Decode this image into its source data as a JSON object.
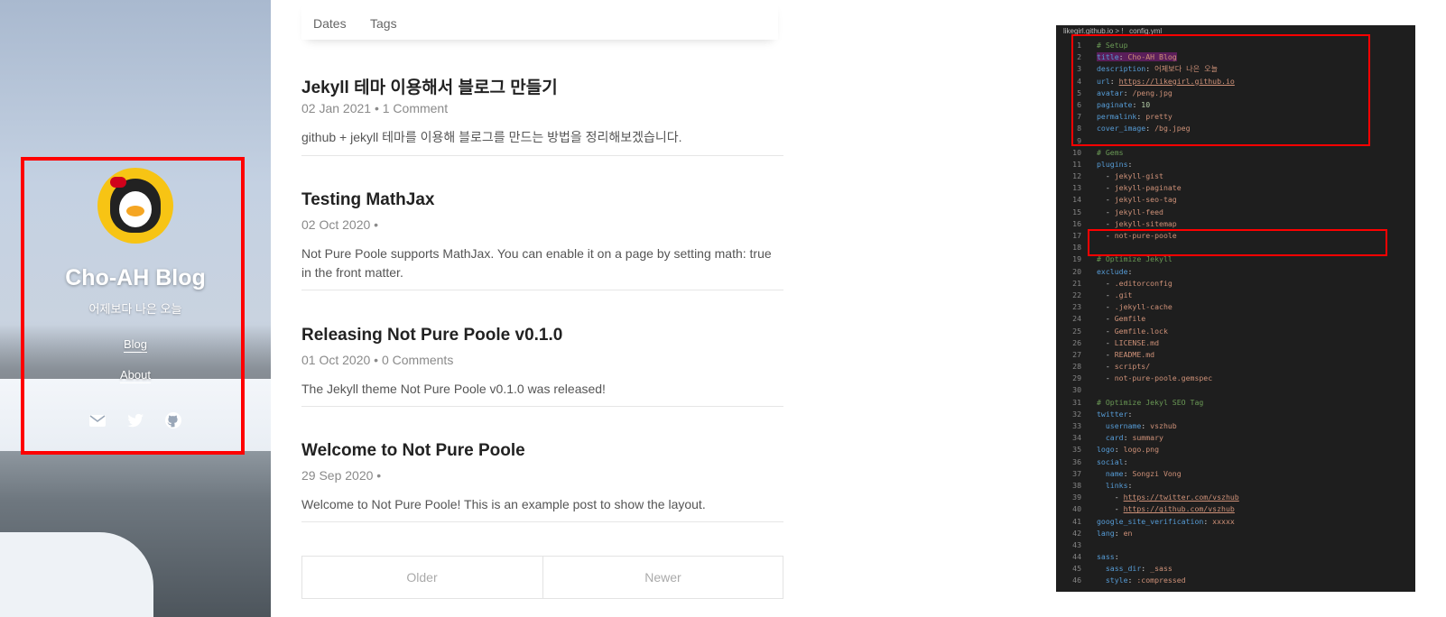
{
  "sidebar": {
    "title": "Cho-AH Blog",
    "description": "어제보다 나은 오늘",
    "nav": [
      {
        "label": "Blog"
      },
      {
        "label": "About"
      }
    ],
    "social_icons": [
      "email-icon",
      "twitter-icon",
      "github-icon"
    ]
  },
  "tabs": [
    {
      "label": "Dates"
    },
    {
      "label": "Tags"
    }
  ],
  "posts": [
    {
      "title": "Jekyll 테마 이용해서 블로그 만들기",
      "meta": "02 Jan 2021 • 1 Comment",
      "excerpt": "github + jekyll 테마를 이용해 블로그를 만드는 방법을 정리해보겠습니다."
    },
    {
      "title": "Testing MathJax",
      "meta": "02 Oct 2020 •",
      "excerpt": "Not Pure Poole supports MathJax. You can enable it on a page by setting math: true in the front matter."
    },
    {
      "title": "Releasing Not Pure Poole v0.1.0",
      "meta": "01 Oct 2020 • 0 Comments",
      "excerpt": "The Jekyll theme Not Pure Poole v0.1.0 was released!"
    },
    {
      "title": "Welcome to Not Pure Poole",
      "meta": "29 Sep 2020 •",
      "excerpt": "Welcome to Not Pure Poole! This is an example post to show the layout."
    }
  ],
  "pager": {
    "older": "Older",
    "newer": "Newer"
  },
  "editor": {
    "breadcrumb": "likegirl.github.io  >  !  _config.yml",
    "lines": [
      {
        "n": "1",
        "parts": [
          {
            "t": "# Setup",
            "c": "c-comment"
          }
        ]
      },
      {
        "n": "2",
        "parts": [
          {
            "t": "title",
            "c": "c-key hl"
          },
          {
            "t": ": ",
            "c": "c-punct hl"
          },
          {
            "t": "Cho-AH Blog",
            "c": "c-str hl"
          }
        ]
      },
      {
        "n": "3",
        "parts": [
          {
            "t": "description",
            "c": "c-key"
          },
          {
            "t": ": ",
            "c": "c-punct"
          },
          {
            "t": "어제보다 나은 오늘",
            "c": "c-str"
          }
        ]
      },
      {
        "n": "4",
        "parts": [
          {
            "t": "url",
            "c": "c-key"
          },
          {
            "t": ": ",
            "c": "c-punct"
          },
          {
            "t": "https://likegirl.github.io",
            "c": "c-link"
          }
        ]
      },
      {
        "n": "5",
        "parts": [
          {
            "t": "avatar",
            "c": "c-key"
          },
          {
            "t": ": ",
            "c": "c-punct"
          },
          {
            "t": "/peng.jpg",
            "c": "c-str"
          }
        ]
      },
      {
        "n": "6",
        "parts": [
          {
            "t": "paginate",
            "c": "c-key"
          },
          {
            "t": ": ",
            "c": "c-punct"
          },
          {
            "t": "10",
            "c": "c-num"
          }
        ]
      },
      {
        "n": "7",
        "parts": [
          {
            "t": "permalink",
            "c": "c-key"
          },
          {
            "t": ": ",
            "c": "c-punct"
          },
          {
            "t": "pretty",
            "c": "c-str"
          }
        ]
      },
      {
        "n": "8",
        "parts": [
          {
            "t": "cover_image",
            "c": "c-key"
          },
          {
            "t": ": ",
            "c": "c-punct"
          },
          {
            "t": "/bg.jpeg",
            "c": "c-str"
          }
        ]
      },
      {
        "n": "9",
        "parts": []
      },
      {
        "n": "10",
        "parts": [
          {
            "t": "# Gems",
            "c": "c-comment"
          }
        ]
      },
      {
        "n": "11",
        "parts": [
          {
            "t": "plugins",
            "c": "c-key"
          },
          {
            "t": ":",
            "c": "c-punct"
          }
        ]
      },
      {
        "n": "12",
        "parts": [
          {
            "t": "  - ",
            "c": "c-punct"
          },
          {
            "t": "jekyll-gist",
            "c": "c-str"
          }
        ]
      },
      {
        "n": "13",
        "parts": [
          {
            "t": "  - ",
            "c": "c-punct"
          },
          {
            "t": "jekyll-paginate",
            "c": "c-str"
          }
        ]
      },
      {
        "n": "14",
        "parts": [
          {
            "t": "  - ",
            "c": "c-punct"
          },
          {
            "t": "jekyll-seo-tag",
            "c": "c-str"
          }
        ]
      },
      {
        "n": "15",
        "parts": [
          {
            "t": "  - ",
            "c": "c-punct"
          },
          {
            "t": "jekyll-feed",
            "c": "c-str"
          }
        ]
      },
      {
        "n": "16",
        "parts": [
          {
            "t": "  - ",
            "c": "c-punct"
          },
          {
            "t": "jekyll-sitemap",
            "c": "c-str"
          }
        ]
      },
      {
        "n": "17",
        "parts": [
          {
            "t": "  - ",
            "c": "c-punct"
          },
          {
            "t": "not-pure-poole",
            "c": "c-str"
          }
        ]
      },
      {
        "n": "18",
        "parts": []
      },
      {
        "n": "19",
        "parts": [
          {
            "t": "# Optimize Jekyll",
            "c": "c-comment"
          }
        ]
      },
      {
        "n": "20",
        "parts": [
          {
            "t": "exclude",
            "c": "c-key"
          },
          {
            "t": ":",
            "c": "c-punct"
          }
        ]
      },
      {
        "n": "21",
        "parts": [
          {
            "t": "  - ",
            "c": "c-punct"
          },
          {
            "t": ".editorconfig",
            "c": "c-str"
          }
        ]
      },
      {
        "n": "22",
        "parts": [
          {
            "t": "  - ",
            "c": "c-punct"
          },
          {
            "t": ".git",
            "c": "c-str"
          }
        ]
      },
      {
        "n": "23",
        "parts": [
          {
            "t": "  - ",
            "c": "c-punct"
          },
          {
            "t": ".jekyll-cache",
            "c": "c-str"
          }
        ]
      },
      {
        "n": "24",
        "parts": [
          {
            "t": "  - ",
            "c": "c-punct"
          },
          {
            "t": "Gemfile",
            "c": "c-str"
          }
        ]
      },
      {
        "n": "25",
        "parts": [
          {
            "t": "  - ",
            "c": "c-punct"
          },
          {
            "t": "Gemfile.lock",
            "c": "c-str"
          }
        ]
      },
      {
        "n": "26",
        "parts": [
          {
            "t": "  - ",
            "c": "c-punct"
          },
          {
            "t": "LICENSE.md",
            "c": "c-str"
          }
        ]
      },
      {
        "n": "27",
        "parts": [
          {
            "t": "  - ",
            "c": "c-punct"
          },
          {
            "t": "README.md",
            "c": "c-str"
          }
        ]
      },
      {
        "n": "28",
        "parts": [
          {
            "t": "  - ",
            "c": "c-punct"
          },
          {
            "t": "scripts/",
            "c": "c-str"
          }
        ]
      },
      {
        "n": "29",
        "parts": [
          {
            "t": "  - ",
            "c": "c-punct"
          },
          {
            "t": "not-pure-poole.gemspec",
            "c": "c-str"
          }
        ]
      },
      {
        "n": "30",
        "parts": []
      },
      {
        "n": "31",
        "parts": [
          {
            "t": "# Optimize Jekyl SEO Tag",
            "c": "c-comment"
          }
        ]
      },
      {
        "n": "32",
        "parts": [
          {
            "t": "twitter",
            "c": "c-key"
          },
          {
            "t": ":",
            "c": "c-punct"
          }
        ]
      },
      {
        "n": "33",
        "parts": [
          {
            "t": "  username",
            "c": "c-key"
          },
          {
            "t": ": ",
            "c": "c-punct"
          },
          {
            "t": "vszhub",
            "c": "c-str"
          }
        ]
      },
      {
        "n": "34",
        "parts": [
          {
            "t": "  card",
            "c": "c-key"
          },
          {
            "t": ": ",
            "c": "c-punct"
          },
          {
            "t": "summary",
            "c": "c-str"
          }
        ]
      },
      {
        "n": "35",
        "parts": [
          {
            "t": "logo",
            "c": "c-key"
          },
          {
            "t": ": ",
            "c": "c-punct"
          },
          {
            "t": "logo.png",
            "c": "c-str"
          }
        ]
      },
      {
        "n": "36",
        "parts": [
          {
            "t": "social",
            "c": "c-key"
          },
          {
            "t": ":",
            "c": "c-punct"
          }
        ]
      },
      {
        "n": "37",
        "parts": [
          {
            "t": "  name",
            "c": "c-key"
          },
          {
            "t": ": ",
            "c": "c-punct"
          },
          {
            "t": "Songzi Vong",
            "c": "c-str"
          }
        ]
      },
      {
        "n": "38",
        "parts": [
          {
            "t": "  links",
            "c": "c-key"
          },
          {
            "t": ":",
            "c": "c-punct"
          }
        ]
      },
      {
        "n": "39",
        "parts": [
          {
            "t": "    - ",
            "c": "c-punct"
          },
          {
            "t": "https://twitter.com/vszhub",
            "c": "c-link"
          }
        ]
      },
      {
        "n": "40",
        "parts": [
          {
            "t": "    - ",
            "c": "c-punct"
          },
          {
            "t": "https://github.com/vszhub",
            "c": "c-link"
          }
        ]
      },
      {
        "n": "41",
        "parts": [
          {
            "t": "google_site_verification",
            "c": "c-key"
          },
          {
            "t": ": ",
            "c": "c-punct"
          },
          {
            "t": "xxxxx",
            "c": "c-str"
          }
        ]
      },
      {
        "n": "42",
        "parts": [
          {
            "t": "lang",
            "c": "c-key"
          },
          {
            "t": ": ",
            "c": "c-punct"
          },
          {
            "t": "en",
            "c": "c-str"
          }
        ]
      },
      {
        "n": "43",
        "parts": []
      },
      {
        "n": "44",
        "parts": [
          {
            "t": "sass",
            "c": "c-key"
          },
          {
            "t": ":",
            "c": "c-punct"
          }
        ]
      },
      {
        "n": "45",
        "parts": [
          {
            "t": "  sass_dir",
            "c": "c-key"
          },
          {
            "t": ": ",
            "c": "c-punct"
          },
          {
            "t": "_sass",
            "c": "c-str"
          }
        ]
      },
      {
        "n": "46",
        "parts": [
          {
            "t": "  style",
            "c": "c-key"
          },
          {
            "t": ": ",
            "c": "c-punct"
          },
          {
            "t": ":compressed",
            "c": "c-str"
          }
        ]
      }
    ]
  },
  "colors": {
    "highlight_box": "#ff0000",
    "editor_bg": "#1e1e1e",
    "avatar_bg": "#f7c414"
  }
}
